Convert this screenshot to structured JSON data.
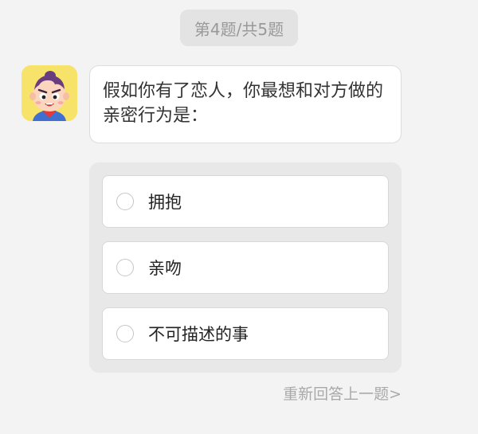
{
  "progress": {
    "label": "第4题/共5题",
    "current": 4,
    "total": 5
  },
  "assistant": {
    "avatar_icon": "cartoon-boy-avatar-icon",
    "avatar_bg": "#f7e36a"
  },
  "question": {
    "text": "假如你有了恋人，你最想和对方做的亲密行为是："
  },
  "options": [
    {
      "label": "拥抱",
      "selected": false
    },
    {
      "label": "亲吻",
      "selected": false
    },
    {
      "label": "不可描述的事",
      "selected": false
    }
  ],
  "redo": {
    "label": "重新回答上一题>"
  },
  "colors": {
    "page_bg": "#f3f3f3",
    "pill_bg": "#e3e3e3",
    "panel_bg": "#e8e8e8",
    "muted_text": "#a9a9a9"
  }
}
